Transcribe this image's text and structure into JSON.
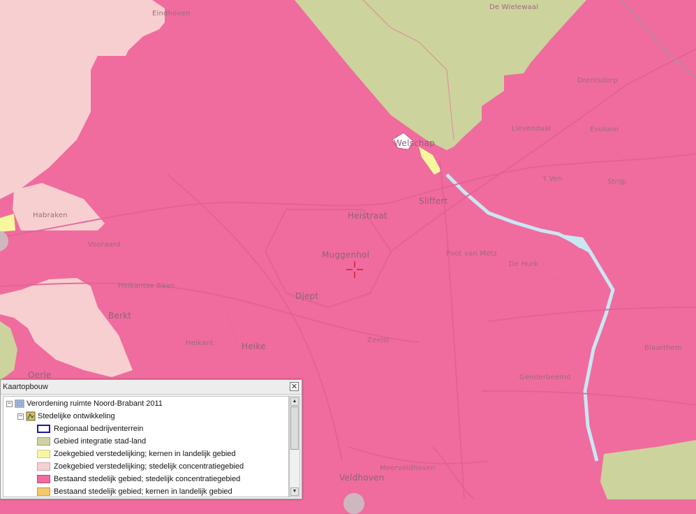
{
  "map": {
    "colors": {
      "stedelijk": "#f06c9e",
      "integratie": "#cdd39d",
      "zoekgebied_stedelijk": "#f8cfd0",
      "zoekgebied_kernen": "#f7f79e",
      "water": "#c9e7f3"
    },
    "places": [
      {
        "id": "eindhoven",
        "name": "Eindhoven"
      },
      {
        "id": "de-wielewaal",
        "name": "De Wielewaal"
      },
      {
        "id": "drentsdorp",
        "name": "Drentsdorp"
      },
      {
        "id": "lievendaal",
        "name": "Lievendaal"
      },
      {
        "id": "evoluon",
        "name": "Evoluon"
      },
      {
        "id": "welschap",
        "name": "Welschap"
      },
      {
        "id": "t-ven",
        "name": "'t Ven"
      },
      {
        "id": "strijp",
        "name": "Strijp"
      },
      {
        "id": "habraken",
        "name": "Habraken"
      },
      {
        "id": "sliffert",
        "name": "Sliffert"
      },
      {
        "id": "heistraat",
        "name": "Heistraat"
      },
      {
        "id": "vooraard",
        "name": "Vooraard"
      },
      {
        "id": "muggenhol",
        "name": "Muggenhol"
      },
      {
        "id": "poot-van-metz",
        "name": "Poot van Metz"
      },
      {
        "id": "de-hurk",
        "name": "De Hurk"
      },
      {
        "id": "heikantse-baan",
        "name": "Heikantse Baan"
      },
      {
        "id": "djept",
        "name": "Djept"
      },
      {
        "id": "berkt",
        "name": "Berkt"
      },
      {
        "id": "zeelst",
        "name": "Zeelst"
      },
      {
        "id": "heikant",
        "name": "Heikant"
      },
      {
        "id": "heike",
        "name": "Heike"
      },
      {
        "id": "blaarthem",
        "name": "Blaarthem"
      },
      {
        "id": "oerle",
        "name": "Oerle"
      },
      {
        "id": "genderbeemd",
        "name": "Genderbeemd"
      },
      {
        "id": "meerveldhoven",
        "name": "Meerveldhoven"
      },
      {
        "id": "veldhoven",
        "name": "Veldhoven"
      }
    ]
  },
  "panel": {
    "title": "Kaartopbouw",
    "close_symbol": "✕",
    "tree": {
      "root_label": "Verordening ruimte Noord-Brabant 2011",
      "group_label": "Stedelijke ontwikkeling",
      "expander_symbol": "−",
      "legend": [
        {
          "label": "Regionaal bedrijventerrein",
          "fill": "#ffffff",
          "border": "#1a1aa6"
        },
        {
          "label": "Gebied integratie stad-land",
          "fill": "#cdd39d",
          "border": "#9c9c9c"
        },
        {
          "label": "Zoekgebied verstedelijking; kernen in landelijk gebied",
          "fill": "#f7f79e",
          "border": "#c8c8a0"
        },
        {
          "label": "Zoekgebied verstedelijking; stedelijk concentratiegebied",
          "fill": "#f8cfd0",
          "border": "#c8a8a8"
        },
        {
          "label": "Bestaand stedelijk gebied; stedelijk concentratiegebied",
          "fill": "#f06c9e",
          "border": "#b05070"
        },
        {
          "label": "Bestaand stedelijk gebied; kernen in landelijk gebied",
          "fill": "#f7c86a",
          "border": "#c09a50"
        }
      ]
    },
    "scroll": {
      "up_symbol": "▲",
      "down_symbol": "▼"
    }
  }
}
